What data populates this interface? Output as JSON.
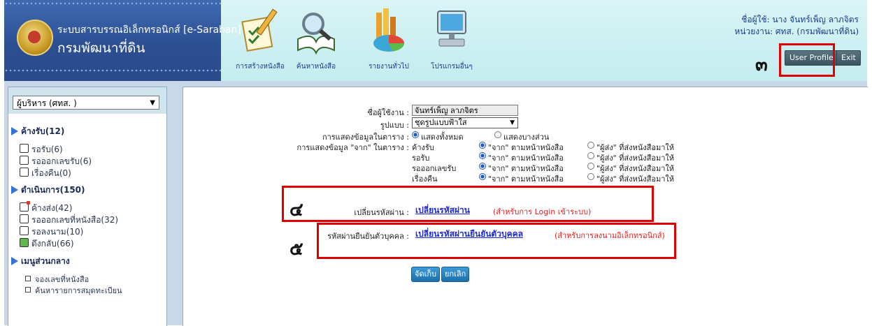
{
  "header": {
    "system_title": "ระบบสารบรรณอิเล็กทรอนิกส์ [e-Saraban]",
    "org_name": "กรมพัฒนาที่ดิน",
    "menu": [
      {
        "label": "การสร้างหนังสือ",
        "icon": "pencil-checklist-icon"
      },
      {
        "label": "ค้นหาหนังสือ",
        "icon": "magnifier-book-icon"
      },
      {
        "label": "รายงานทั่วไป",
        "icon": "bar-pie-chart-icon"
      },
      {
        "label": "โปรแกรมอื่นๆ",
        "icon": "computer-monitor-icon"
      }
    ],
    "user_line": "ชื่อผู้ใช้: นาง จันทร์เพ็ญ ลาภจิตร",
    "unit_line": "หน่วยงาน: ศทส. (กรมพัฒนาที่ดิน)",
    "user_profile_label": "User Profile",
    "exit_label": "Exit"
  },
  "sidebar": {
    "role_select": "ผู้บริหาร (ศทส. )",
    "sections": [
      {
        "title": "ค้างรับ(12)",
        "items": [
          "รอรับ(6)",
          "รอออกเลขรับ(6)",
          "เรื่องคืน(0)"
        ]
      },
      {
        "title": "ดำเนินการ(150)",
        "items": [
          "ค้างส่ง(42)",
          "รอออกเลขที่หนังสือ(32)",
          "รอลงนาม(10)",
          "ดึงกลับ(66)"
        ]
      },
      {
        "title": "เมนูส่วนกลาง",
        "items": [
          "จองเลขที่หนังสือ",
          "ค้นหารายการสมุดทะเบียน"
        ]
      }
    ]
  },
  "form": {
    "username_label": "ชื่อผู้ใช้งาน :",
    "username_value": "จันทร์เพ็ญ ลาภจิตร",
    "theme_label": "รูปแบบ :",
    "theme_value": "ชุดรูปแบบฟ้าใส",
    "table_display_label": "การแสดงข้อมูลในตาราง :",
    "table_display_options": [
      "แสดงทั้งหมด",
      "แสดงบางส่วน"
    ],
    "from_display_label": "การแสดงข้อมูล \"จาก\" ในตาราง :",
    "from_rows": [
      "ค้างรับ",
      "รอรับ",
      "รอออกเลขรับ",
      "เรื่องคืน"
    ],
    "from_option_a": "\"จาก\" ตามหน้าหนังสือ",
    "from_option_b": "\"ผู้ส่ง\" ที่ส่งหนังสือมาให้",
    "password_label": "เปลี่ยนรหัสผ่าน :",
    "password_link": "เปลี่ยนรหัสผ่าน",
    "password_note": "(สำหรับการ Login เข้าระบบ)",
    "pin_label": "รหัสผ่านยืนยันตัวบุคคล :",
    "pin_link": "เปลี่ยนรหัสผ่านยืนยันตัวบุคคล",
    "pin_note": "(สำหรับการลงนามอิเล็กทรอนิกส์)",
    "save_label": "จัดเก็บ",
    "cancel_label": "ยกเลิก"
  },
  "annotations": {
    "n3": "๓",
    "n4": "๔",
    "n5": "๕"
  },
  "colors": {
    "highlight": "#e00000",
    "link": "#1f2ad0",
    "note": "#e02020",
    "header_band": "#2c4f93"
  }
}
